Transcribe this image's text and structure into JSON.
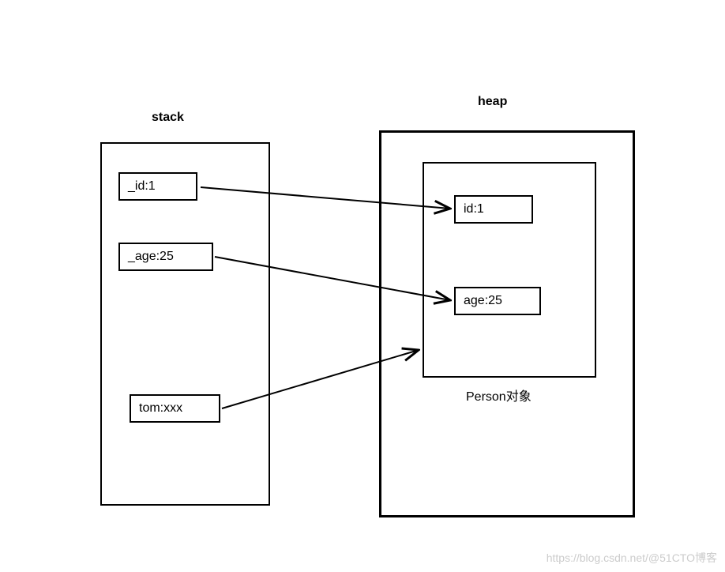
{
  "labels": {
    "stack": "stack",
    "heap": "heap",
    "person": "Person对象"
  },
  "stack_items": {
    "id": "_id:1",
    "age": "_age:25",
    "tom": "tom:xxx"
  },
  "heap_items": {
    "id": "id:1",
    "age": "age:25"
  },
  "watermark": "https://blog.csdn.net/@51CTO博客",
  "chart_data": {
    "type": "diagram",
    "title": "Stack and Heap memory diagram",
    "regions": [
      {
        "name": "stack",
        "items": [
          "_id:1",
          "_age:25",
          "tom:xxx"
        ]
      },
      {
        "name": "heap",
        "objects": [
          {
            "label": "Person对象",
            "fields": [
              "id:1",
              "age:25"
            ]
          }
        ]
      }
    ],
    "arrows": [
      {
        "from": "_id:1",
        "to": "id:1"
      },
      {
        "from": "_age:25",
        "to": "age:25"
      },
      {
        "from": "tom:xxx",
        "to": "Person对象"
      }
    ]
  }
}
